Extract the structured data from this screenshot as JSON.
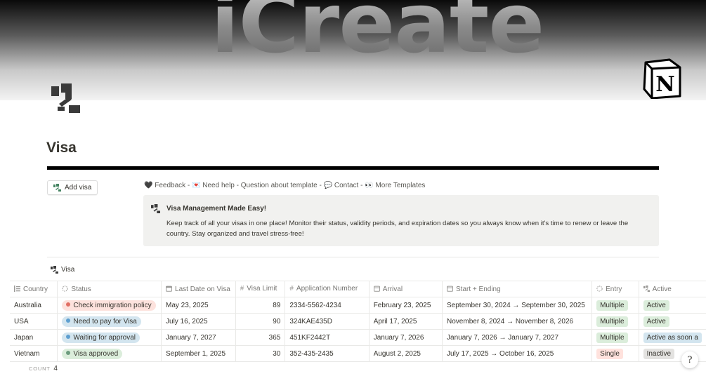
{
  "cover": {
    "title": "iCreate"
  },
  "page": {
    "title": "Visa"
  },
  "actions": {
    "add_label": "Add visa"
  },
  "links": {
    "feedback": "🖤 Feedback",
    "help": "💌 Need help",
    "question": "Question about template",
    "contact": "💬 Contact",
    "templates": "👀 More Templates",
    "separator": " - "
  },
  "callout": {
    "title": "Visa Management Made Easy!",
    "body": "Keep track of all your visas in one place! Monitor their status, validity periods, and expiration dates so you always know when it's time to renew or leave the country. Stay organized and travel stress-free!"
  },
  "view": {
    "tab_label": "Visa"
  },
  "table": {
    "columns": {
      "country": "Country",
      "status": "Status",
      "last_date": "Last Date on Visa",
      "limit": "Visa Limit",
      "app_number": "Application Number",
      "arrival": "Arrival",
      "start_end": "Start + Ending",
      "entry": "Entry",
      "active": "Active"
    },
    "rows": [
      {
        "country": "Australia",
        "status": "Check immigration policy",
        "last_date": "May 23, 2025",
        "limit": "89",
        "app_number": "2334-5562-4234",
        "arrival": "February 23, 2025",
        "start_end": "September 30, 2024 → September 30, 2025",
        "entry": "Multiple",
        "active": "Active"
      },
      {
        "country": "USA",
        "status": "Need to pay for Visa",
        "last_date": "July 16, 2025",
        "limit": "90",
        "app_number": "324KAE435D",
        "arrival": "April 17, 2025",
        "start_end": "November 8, 2024 → November 8, 2026",
        "entry": "Multiple",
        "active": "Active"
      },
      {
        "country": "Japan",
        "status": "Waiting for approval",
        "last_date": "January 7, 2027",
        "limit": "365",
        "app_number": "451KF2442T",
        "arrival": "January 7, 2026",
        "start_end": "January 7, 2026 → January 7, 2027",
        "entry": "Multiple",
        "active": "Active as soon a"
      },
      {
        "country": "Vietnam",
        "status": "Visa approved",
        "last_date": "September 1, 2025",
        "limit": "30",
        "app_number": "352-435-2435",
        "arrival": "August 2, 2025",
        "start_end": "July 17, 2025 → October 16, 2025",
        "entry": "Single",
        "active": "Inactive"
      }
    ],
    "count_label": "COUNT",
    "count_value": "4"
  },
  "help": {
    "label": "?"
  },
  "colors": {
    "red_pill_bg": "#fde2dd",
    "red_dot": "#e16f64",
    "blue_pill_bg": "#d3e5ef",
    "blue_dot": "#5e9fd0",
    "green_pill_bg": "#dbeddb",
    "green_dot": "#6c9b7d",
    "multiple_bg": "#dbeddb",
    "single_bg": "#ffe2dd",
    "active_bg": "#dbeddb",
    "active_blue_bg": "#d3e5ef",
    "inactive_bg": "#e3e2e0"
  },
  "icons": [
    "visa-icon",
    "notion-logo-icon",
    "list-icon",
    "status-icon",
    "calendar-icon",
    "hash-icon",
    "multi-select-icon",
    "relation-icon",
    "help-icon"
  ]
}
